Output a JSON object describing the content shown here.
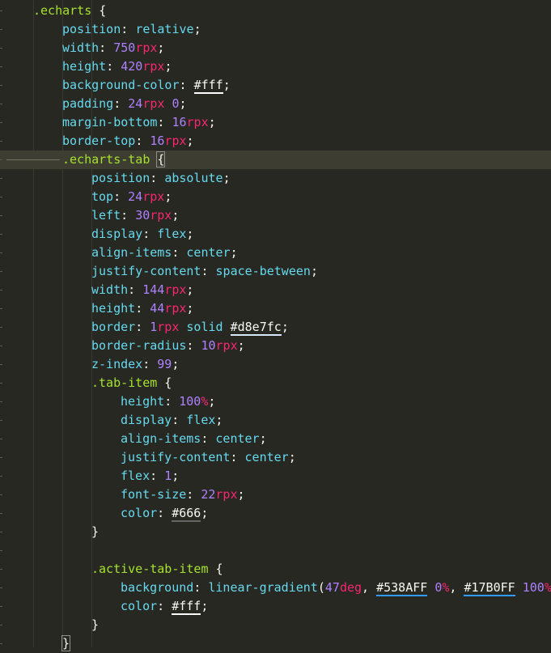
{
  "editor": {
    "lines": [
      [
        [
          "sel",
          ".echarts"
        ],
        [
          "punc",
          " {"
        ]
      ],
      [
        [
          "prop",
          "position"
        ],
        [
          "punc",
          ": "
        ],
        [
          "val",
          "relative"
        ],
        [
          "punc",
          ";"
        ]
      ],
      [
        [
          "prop",
          "width"
        ],
        [
          "punc",
          ": "
        ],
        [
          "num",
          "750"
        ],
        [
          "unit",
          "rpx"
        ],
        [
          "punc",
          ";"
        ]
      ],
      [
        [
          "prop",
          "height"
        ],
        [
          "punc",
          ": "
        ],
        [
          "num",
          "420"
        ],
        [
          "unit",
          "rpx"
        ],
        [
          "punc",
          ";"
        ]
      ],
      [
        [
          "prop",
          "background-color"
        ],
        [
          "punc",
          ": "
        ],
        [
          "color-white",
          "#fff"
        ],
        [
          "punc",
          ";"
        ]
      ],
      [
        [
          "prop",
          "padding"
        ],
        [
          "punc",
          ": "
        ],
        [
          "num",
          "24"
        ],
        [
          "unit",
          "rpx"
        ],
        [
          "punc",
          " "
        ],
        [
          "num",
          "0"
        ],
        [
          "punc",
          ";"
        ]
      ],
      [
        [
          "prop",
          "margin-bottom"
        ],
        [
          "punc",
          ": "
        ],
        [
          "num",
          "16"
        ],
        [
          "unit",
          "rpx"
        ],
        [
          "punc",
          ";"
        ]
      ],
      [
        [
          "prop",
          "border-top"
        ],
        [
          "punc",
          ": "
        ],
        [
          "num",
          "16"
        ],
        [
          "unit",
          "rpx"
        ],
        [
          "punc",
          ";"
        ]
      ],
      [
        [
          "sel",
          ".echarts-tab"
        ],
        [
          "punc",
          " "
        ],
        [
          "brace",
          "{"
        ]
      ],
      [
        [
          "prop",
          "position"
        ],
        [
          "punc",
          ": "
        ],
        [
          "val",
          "absolute"
        ],
        [
          "punc",
          ";"
        ]
      ],
      [
        [
          "prop",
          "top"
        ],
        [
          "punc",
          ": "
        ],
        [
          "num",
          "24"
        ],
        [
          "unit",
          "rpx"
        ],
        [
          "punc",
          ";"
        ]
      ],
      [
        [
          "prop",
          "left"
        ],
        [
          "punc",
          ": "
        ],
        [
          "num",
          "30"
        ],
        [
          "unit",
          "rpx"
        ],
        [
          "punc",
          ";"
        ]
      ],
      [
        [
          "prop",
          "display"
        ],
        [
          "punc",
          ": "
        ],
        [
          "val",
          "flex"
        ],
        [
          "punc",
          ";"
        ]
      ],
      [
        [
          "prop",
          "align-items"
        ],
        [
          "punc",
          ": "
        ],
        [
          "val",
          "center"
        ],
        [
          "punc",
          ";"
        ]
      ],
      [
        [
          "prop",
          "justify-content"
        ],
        [
          "punc",
          ": "
        ],
        [
          "val",
          "space-between"
        ],
        [
          "punc",
          ";"
        ]
      ],
      [
        [
          "prop",
          "width"
        ],
        [
          "punc",
          ": "
        ],
        [
          "num",
          "144"
        ],
        [
          "unit",
          "rpx"
        ],
        [
          "punc",
          ";"
        ]
      ],
      [
        [
          "prop",
          "height"
        ],
        [
          "punc",
          ": "
        ],
        [
          "num",
          "44"
        ],
        [
          "unit",
          "rpx"
        ],
        [
          "punc",
          ";"
        ]
      ],
      [
        [
          "prop",
          "border"
        ],
        [
          "punc",
          ": "
        ],
        [
          "num",
          "1"
        ],
        [
          "unit",
          "rpx"
        ],
        [
          "punc",
          " "
        ],
        [
          "val",
          "solid"
        ],
        [
          "punc",
          " "
        ],
        [
          "color-light",
          "#d8e7fc"
        ],
        [
          "punc",
          ";"
        ]
      ],
      [
        [
          "prop",
          "border-radius"
        ],
        [
          "punc",
          ": "
        ],
        [
          "num",
          "10"
        ],
        [
          "unit",
          "rpx"
        ],
        [
          "punc",
          ";"
        ]
      ],
      [
        [
          "prop",
          "z-index"
        ],
        [
          "punc",
          ": "
        ],
        [
          "num",
          "99"
        ],
        [
          "punc",
          ";"
        ]
      ],
      [
        [
          "sel",
          ".tab-item"
        ],
        [
          "punc",
          " {"
        ]
      ],
      [
        [
          "prop",
          "height"
        ],
        [
          "punc",
          ": "
        ],
        [
          "num",
          "100"
        ],
        [
          "unit",
          "%"
        ],
        [
          "punc",
          ";"
        ]
      ],
      [
        [
          "prop",
          "display"
        ],
        [
          "punc",
          ": "
        ],
        [
          "val",
          "flex"
        ],
        [
          "punc",
          ";"
        ]
      ],
      [
        [
          "prop",
          "align-items"
        ],
        [
          "punc",
          ": "
        ],
        [
          "val",
          "center"
        ],
        [
          "punc",
          ";"
        ]
      ],
      [
        [
          "prop",
          "justify-content"
        ],
        [
          "punc",
          ": "
        ],
        [
          "val",
          "center"
        ],
        [
          "punc",
          ";"
        ]
      ],
      [
        [
          "prop",
          "flex"
        ],
        [
          "punc",
          ": "
        ],
        [
          "num",
          "1"
        ],
        [
          "punc",
          ";"
        ]
      ],
      [
        [
          "prop",
          "font-size"
        ],
        [
          "punc",
          ": "
        ],
        [
          "num",
          "22"
        ],
        [
          "unit",
          "rpx"
        ],
        [
          "punc",
          ";"
        ]
      ],
      [
        [
          "prop",
          "color"
        ],
        [
          "punc",
          ": "
        ],
        [
          "color-gray",
          "#666"
        ],
        [
          "punc",
          ";"
        ]
      ],
      [
        [
          "punc",
          "}"
        ]
      ],
      [],
      [
        [
          "sel",
          ".active-tab-item"
        ],
        [
          "punc",
          " {"
        ]
      ],
      [
        [
          "prop",
          "background"
        ],
        [
          "punc",
          ": "
        ],
        [
          "fn",
          "linear-gradient"
        ],
        [
          "punc",
          "("
        ],
        [
          "num",
          "47"
        ],
        [
          "unit",
          "deg"
        ],
        [
          "punc",
          ", "
        ],
        [
          "color-blue",
          "#538AFF"
        ],
        [
          "punc",
          " "
        ],
        [
          "num",
          "0"
        ],
        [
          "unit",
          "%"
        ],
        [
          "punc",
          ", "
        ],
        [
          "color-blue",
          "#17B0FF"
        ],
        [
          "punc",
          " "
        ],
        [
          "num",
          "100"
        ],
        [
          "unit",
          "%"
        ]
      ],
      [
        [
          "prop",
          "color"
        ],
        [
          "punc",
          ": "
        ],
        [
          "color-white",
          "#fff"
        ],
        [
          "punc",
          ";"
        ]
      ],
      [
        [
          "punc",
          "}"
        ]
      ],
      [
        [
          "brace",
          "}"
        ]
      ]
    ]
  }
}
